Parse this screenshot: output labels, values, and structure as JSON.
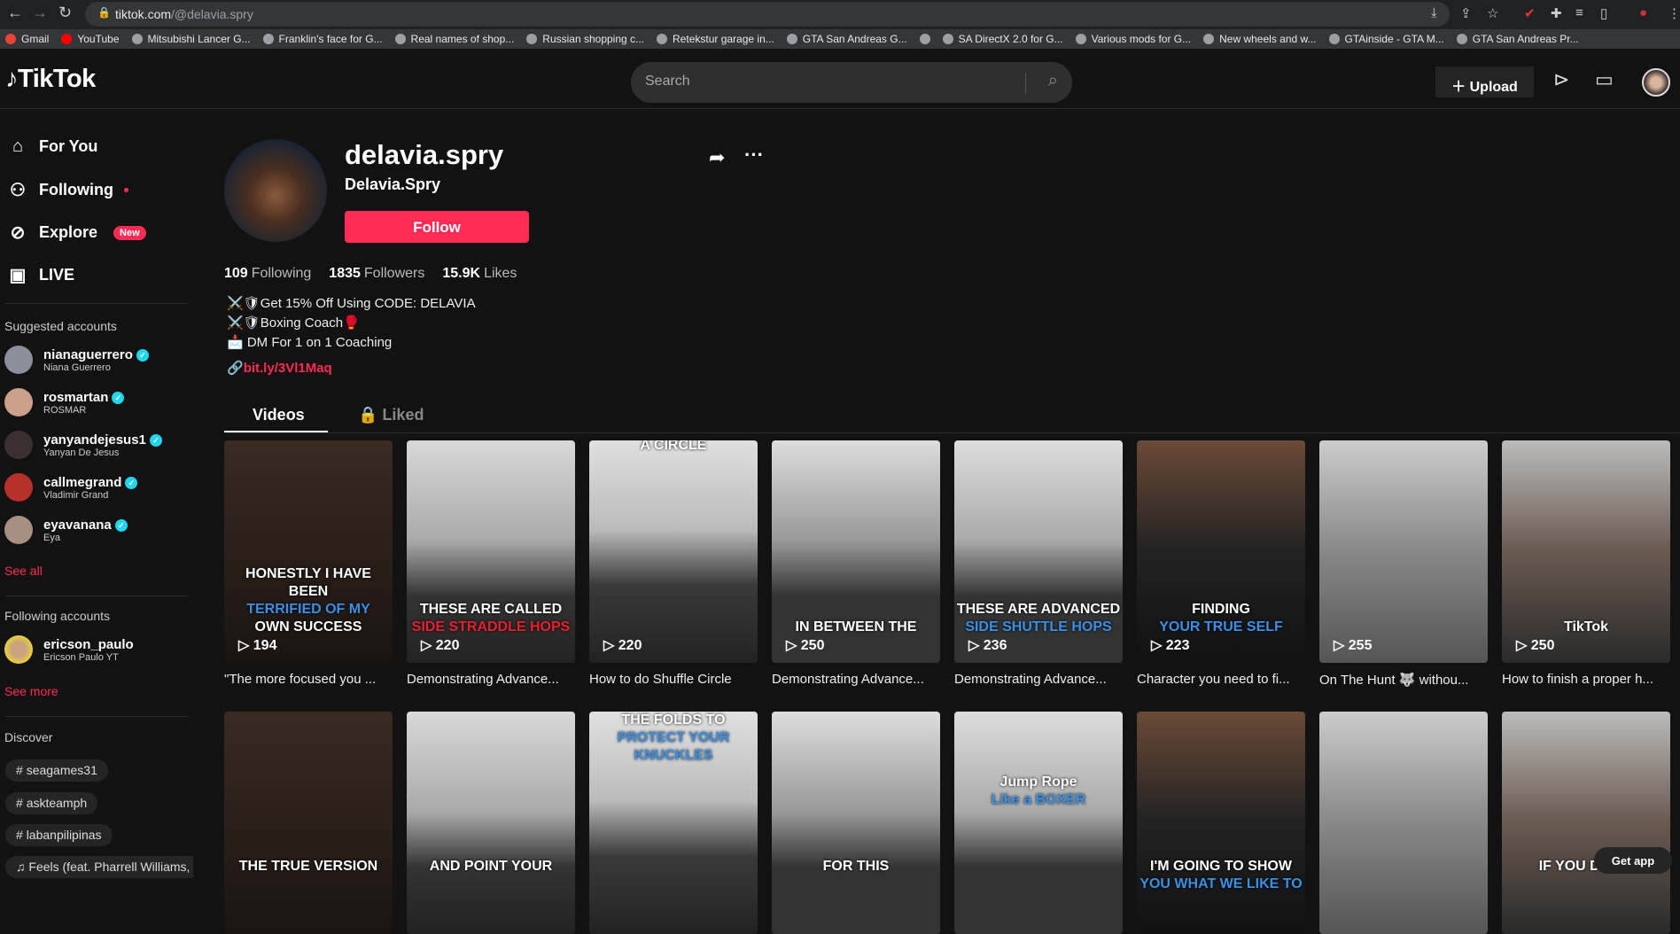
{
  "browser": {
    "url_host": "tiktok.com",
    "url_path": "/@delavia.spry",
    "bookmarks": [
      "Gmail",
      "YouTube",
      "Mitsubishi Lancer G...",
      "Franklin's face for G...",
      "Real names of shop...",
      "Russian shopping c...",
      "Retekstur garage in...",
      "GTA San Andreas G...",
      "",
      "SA DirectX 2.0 for G...",
      "Various mods for G...",
      "New wheels and w...",
      "GTAinside - GTA M...",
      "GTA San Andreas Pr..."
    ]
  },
  "header": {
    "logo": "TikTok",
    "search_placeholder": "Search",
    "upload_label": "Upload"
  },
  "sidebar": {
    "nav": [
      {
        "label": "For You",
        "icon": "home-icon"
      },
      {
        "label": "Following",
        "icon": "users-icon"
      },
      {
        "label": "Explore",
        "icon": "compass-icon",
        "badge": "New"
      },
      {
        "label": "LIVE",
        "icon": "live-icon"
      }
    ],
    "suggested_title": "Suggested accounts",
    "suggested": [
      {
        "username": "nianaguerrero",
        "name": "Niana Guerrero"
      },
      {
        "username": "rosmartan",
        "name": "ROSMAR"
      },
      {
        "username": "yanyandejesus1",
        "name": "Yanyan De Jesus"
      },
      {
        "username": "callmegrand",
        "name": "Vladimir Grand"
      },
      {
        "username": "eyavanana",
        "name": "Eya"
      }
    ],
    "see_all": "See all",
    "following_title": "Following accounts",
    "following": [
      {
        "username": "ericson_paulo",
        "name": "Ericson Paulo YT"
      }
    ],
    "see_more": "See more",
    "discover_title": "Discover",
    "discover": [
      "seagames31",
      "askteamph",
      "labanpilipinas",
      "Feels (feat. Pharrell Williams, Ka"
    ]
  },
  "profile": {
    "username": "delavia.spry",
    "display_name": "Delavia.Spry",
    "follow_label": "Follow",
    "following_count": "109",
    "following_label": "Following",
    "followers_count": "1835",
    "followers_label": "Followers",
    "likes_count": "15.9K",
    "likes_label": "Likes",
    "bio": [
      "⚔️🛡Get 15% Off Using CODE: DELAVIA",
      "⚔️🛡Boxing Coach🥊",
      "📩 DM For 1 on 1 Coaching"
    ],
    "link": "bit.ly/3Vl1Maq"
  },
  "tabs": {
    "videos": "Videos",
    "liked": "Liked"
  },
  "videos": [
    {
      "views": "194",
      "caption": "\"The more focused you ...",
      "overlay": [
        "HONESTLY I HAVE BEEN",
        "TERRIFIED OF MY",
        "OWN SUCCESS"
      ]
    },
    {
      "views": "220",
      "caption": "Demonstrating Advance...",
      "overlay": [
        "THESE ARE CALLED",
        "SIDE STRADDLE HOPS"
      ]
    },
    {
      "views": "220",
      "caption": "How to do Shuffle Circle",
      "overlay": [
        "A CIRCLE"
      ]
    },
    {
      "views": "250",
      "caption": "Demonstrating Advance...",
      "overlay": [
        "IN BETWEEN THE"
      ]
    },
    {
      "views": "236",
      "caption": "Demonstrating Advance...",
      "overlay": [
        "THESE ARE ADVANCED",
        "SIDE SHUTTLE HOPS"
      ]
    },
    {
      "views": "223",
      "caption": "Character you need to fi...",
      "overlay": [
        "FINDING",
        "YOUR TRUE SELF"
      ]
    },
    {
      "views": "255",
      "caption": "On The Hunt 🐺 withou...",
      "overlay": []
    },
    {
      "views": "250",
      "caption": "How to finish a proper h...",
      "overlay": [
        "TikTok"
      ]
    },
    {
      "overlay": [
        "THE TRUE VERSION"
      ]
    },
    {
      "overlay": [
        "AND POINT YOUR"
      ]
    },
    {
      "overlay": [
        "THE FOLDS TO",
        "PROTECT YOUR KNUCKLES"
      ]
    },
    {
      "overlay": [
        "FOR THIS"
      ]
    },
    {
      "overlay": [
        "Jump Rope",
        "Like a BOXER"
      ]
    },
    {
      "overlay": [
        "I'M GOING TO SHOW",
        "YOU WHAT WE LIKE TO"
      ]
    },
    {
      "overlay": []
    },
    {
      "overlay": [
        "IF YOU DON'T"
      ]
    }
  ],
  "get_app": "Get app"
}
